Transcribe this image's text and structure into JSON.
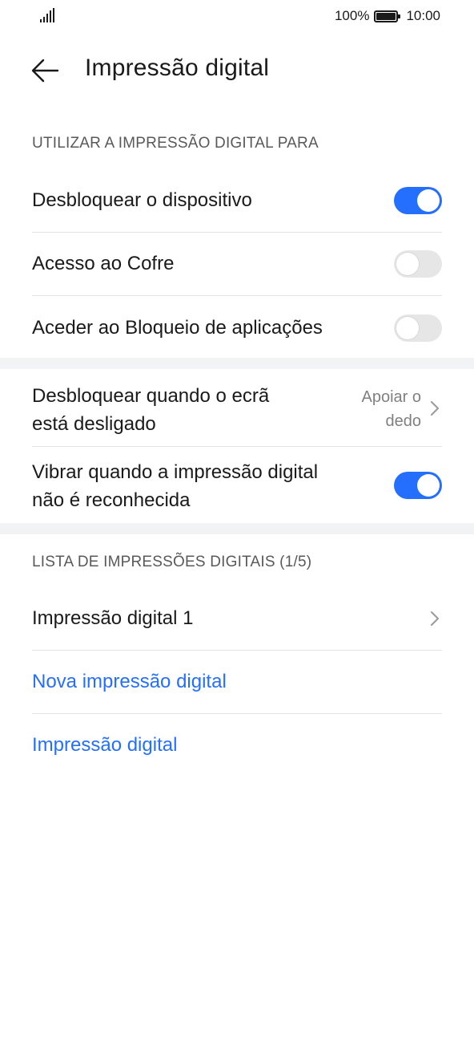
{
  "status_bar": {
    "battery": "100%",
    "time": "10:00"
  },
  "header": {
    "title": "Impressão digital"
  },
  "sections": {
    "use_for": {
      "title": "UTILIZAR A IMPRESSÃO DIGITAL PARA",
      "items": [
        {
          "label": "Desbloquear o dispositivo",
          "toggle": true
        },
        {
          "label": "Acesso ao Cofre",
          "toggle": false
        },
        {
          "label": "Aceder ao Bloqueio de aplicações",
          "toggle": false
        }
      ]
    },
    "screen_off": {
      "label_line1": "Desbloquear quando o ecrã",
      "label_line2": "está desligado",
      "value_line1": "Apoiar o",
      "value_line2": "dedo"
    },
    "vibrate": {
      "label_line1": "Vibrar quando a impressão digital",
      "label_line2": "não é reconhecida",
      "toggle": true
    },
    "list": {
      "title": "LISTA DE IMPRESSÕES DIGITAIS (1/5)",
      "fingerprint_1": "Impressão digital 1",
      "new_fingerprint": "Nova impressão digital",
      "identify": "Impressão digital"
    }
  },
  "colors": {
    "accent": "#256fff",
    "toggle_off": "#e6e6e6",
    "divider": "#e3e3e3",
    "gap": "#f1f3f5"
  }
}
